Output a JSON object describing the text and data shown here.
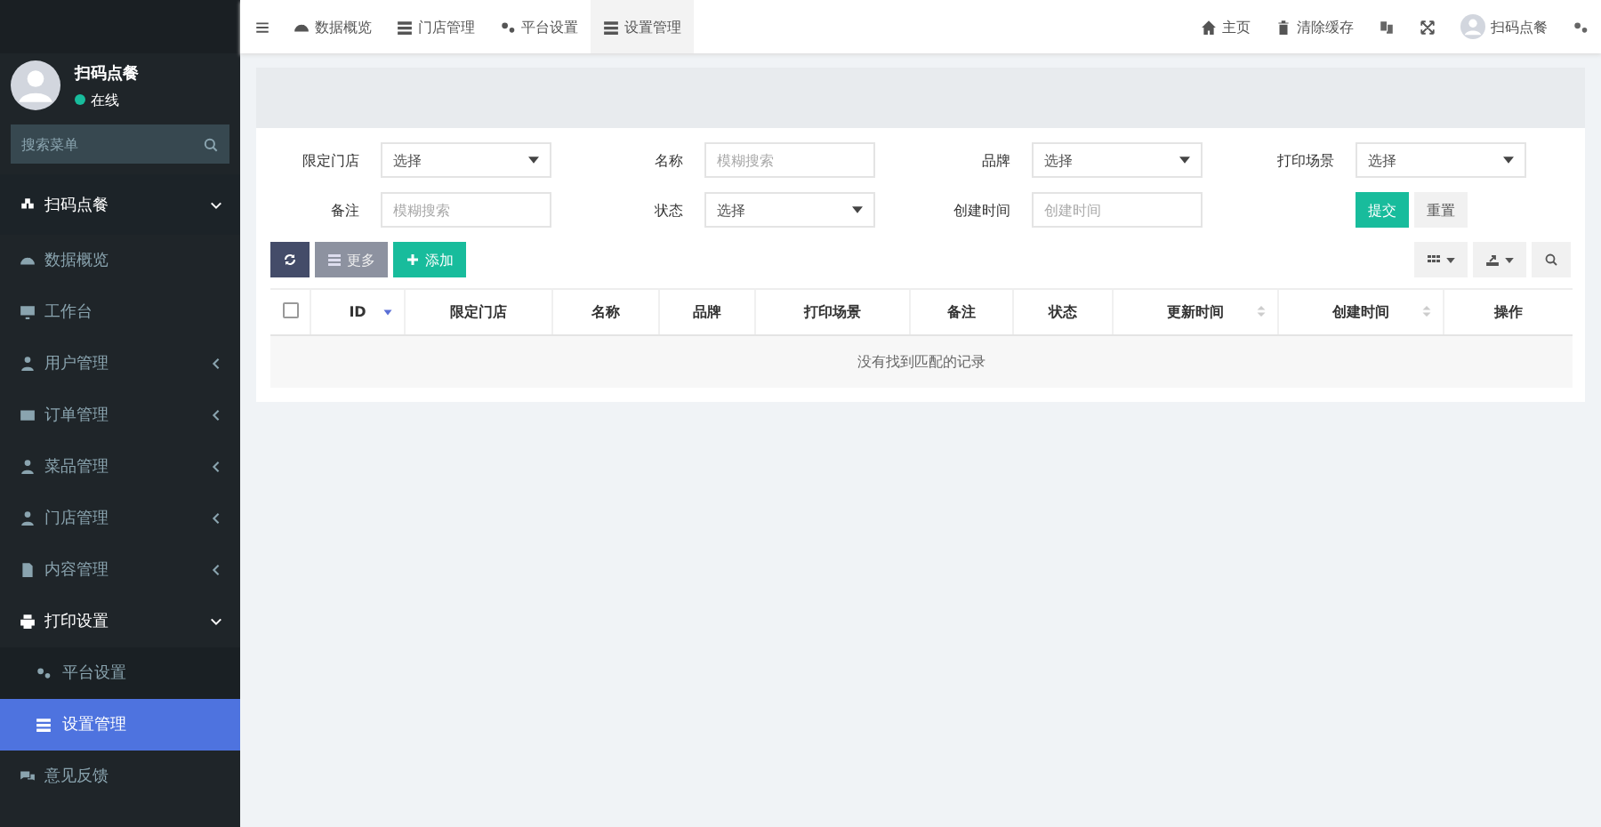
{
  "sidebar": {
    "user": {
      "name": "扫码点餐",
      "status": "在线",
      "online": true
    },
    "search": {
      "placeholder": "搜索菜单"
    },
    "menu": [
      {
        "label": "扫码点餐",
        "kind": "header",
        "expanded": true
      },
      {
        "label": "数据概览",
        "kind": "item"
      },
      {
        "label": "工作台",
        "kind": "item"
      },
      {
        "label": "用户管理",
        "kind": "group",
        "expanded": false
      },
      {
        "label": "订单管理",
        "kind": "group",
        "expanded": false
      },
      {
        "label": "菜品管理",
        "kind": "group",
        "expanded": false
      },
      {
        "label": "门店管理",
        "kind": "group",
        "expanded": false
      },
      {
        "label": "内容管理",
        "kind": "group",
        "expanded": false
      },
      {
        "label": "打印设置",
        "kind": "group",
        "expanded": true,
        "children": [
          {
            "label": "平台设置",
            "selected": false
          },
          {
            "label": "设置管理",
            "selected": true
          }
        ]
      },
      {
        "label": "意见反馈",
        "kind": "item"
      }
    ]
  },
  "topbar": {
    "nav": [
      {
        "label": "数据概览",
        "selected": false
      },
      {
        "label": "门店管理",
        "selected": false
      },
      {
        "label": "平台设置",
        "selected": false
      },
      {
        "label": "设置管理",
        "selected": true
      }
    ],
    "right": [
      "主页",
      "清除缓存"
    ],
    "user": "扫码点餐"
  },
  "filters": [
    {
      "label": "限定门店",
      "kind": "select",
      "value": "选择"
    },
    {
      "label": "名称",
      "kind": "input",
      "placeholder": "模糊搜索"
    },
    {
      "label": "品牌",
      "kind": "select",
      "value": "选择"
    },
    {
      "label": "打印场景",
      "kind": "select",
      "value": "选择"
    },
    {
      "label": "备注",
      "kind": "input",
      "placeholder": "模糊搜索"
    },
    {
      "label": "状态",
      "kind": "select",
      "value": "选择"
    },
    {
      "label": "创建时间",
      "kind": "input",
      "placeholder": "创建时间"
    }
  ],
  "filter_buttons": [
    "提交",
    "重置"
  ],
  "toolbar": {
    "more": "更多",
    "add": "添加"
  },
  "table": {
    "select_all": {
      "checked": false
    },
    "columns": [
      {
        "label": "ID",
        "sorted": true
      },
      {
        "label": "限定门店"
      },
      {
        "label": "名称"
      },
      {
        "label": "品牌"
      },
      {
        "label": "打印场景"
      },
      {
        "label": "备注"
      },
      {
        "label": "状态"
      },
      {
        "label": "更新时间",
        "sorted": false
      },
      {
        "label": "创建时间",
        "sorted": false
      },
      {
        "label": "操作"
      }
    ],
    "empty_message": "没有找到匹配的记录"
  }
}
